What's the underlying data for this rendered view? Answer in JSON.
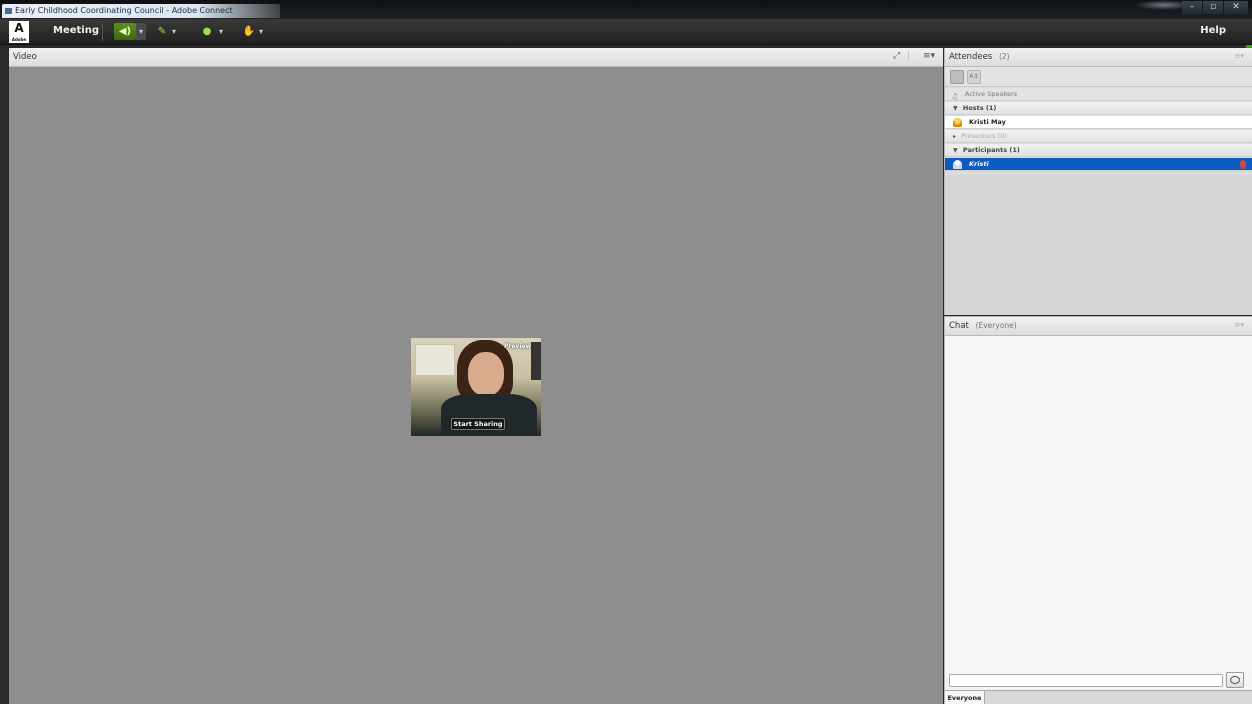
{
  "window": {
    "title": "Early Childhood Coordinating Council - Adobe Connect",
    "controls": {
      "minimize": "–",
      "maximize": "▫",
      "close": "✕"
    }
  },
  "menubar": {
    "logo": "A",
    "logo_sub": "Adobe",
    "meeting": "Meeting",
    "help": "Help",
    "speaker_icon": "speaker-icon",
    "mic_icon": "microphone-icon",
    "camera_icon": "webcam-icon",
    "raise_hand_icon": "raise-hand-icon"
  },
  "video_pod": {
    "title": "Video",
    "fullscreen_icon": "expand-icon",
    "menu_icon": "pod-menu-icon",
    "preview_label": "Preview",
    "start_sharing": "Start Sharing"
  },
  "attendees": {
    "title": "Attendees",
    "count": "(2)",
    "active_speakers": "Active Speakers",
    "hosts_header": "Hosts (1)",
    "host_name": "Kristi May",
    "presenters_header": "Presenters (0)",
    "participants_header": "Participants (1)",
    "participant_name": "Kristi"
  },
  "chat": {
    "title": "Chat",
    "scope": "(Everyone)",
    "tab_everyone": "Everyone",
    "input_value": ""
  },
  "colors": {
    "selected_row": "#0b5bc0",
    "video_bg": "#8e8e8e",
    "toolbar_green": "#5b8f1e"
  }
}
